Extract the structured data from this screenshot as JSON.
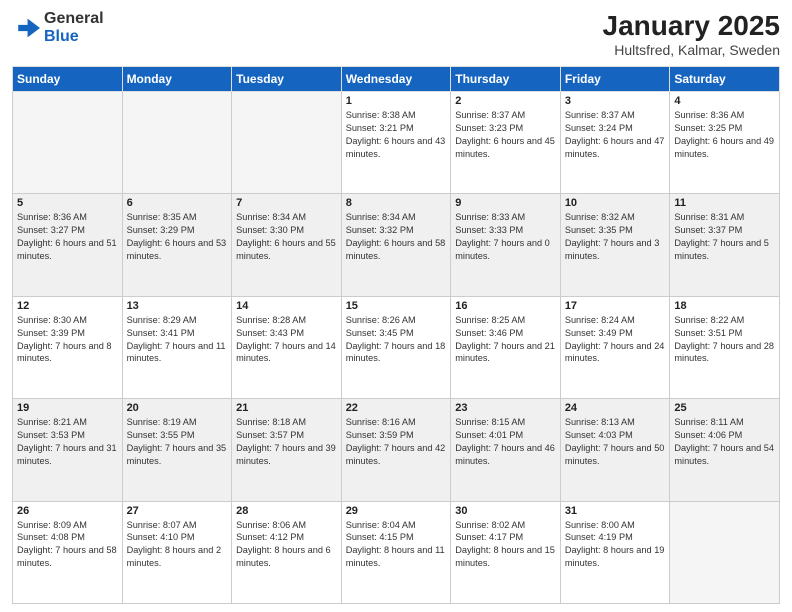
{
  "header": {
    "logo_general": "General",
    "logo_blue": "Blue",
    "month": "January 2025",
    "location": "Hultsfred, Kalmar, Sweden"
  },
  "weekdays": [
    "Sunday",
    "Monday",
    "Tuesday",
    "Wednesday",
    "Thursday",
    "Friday",
    "Saturday"
  ],
  "weeks": [
    [
      {
        "day": "",
        "sunrise": "",
        "sunset": "",
        "daylight": "",
        "empty": true
      },
      {
        "day": "",
        "sunrise": "",
        "sunset": "",
        "daylight": "",
        "empty": true
      },
      {
        "day": "",
        "sunrise": "",
        "sunset": "",
        "daylight": "",
        "empty": true
      },
      {
        "day": "1",
        "sunrise": "Sunrise: 8:38 AM",
        "sunset": "Sunset: 3:21 PM",
        "daylight": "Daylight: 6 hours and 43 minutes."
      },
      {
        "day": "2",
        "sunrise": "Sunrise: 8:37 AM",
        "sunset": "Sunset: 3:23 PM",
        "daylight": "Daylight: 6 hours and 45 minutes."
      },
      {
        "day": "3",
        "sunrise": "Sunrise: 8:37 AM",
        "sunset": "Sunset: 3:24 PM",
        "daylight": "Daylight: 6 hours and 47 minutes."
      },
      {
        "day": "4",
        "sunrise": "Sunrise: 8:36 AM",
        "sunset": "Sunset: 3:25 PM",
        "daylight": "Daylight: 6 hours and 49 minutes."
      }
    ],
    [
      {
        "day": "5",
        "sunrise": "Sunrise: 8:36 AM",
        "sunset": "Sunset: 3:27 PM",
        "daylight": "Daylight: 6 hours and 51 minutes."
      },
      {
        "day": "6",
        "sunrise": "Sunrise: 8:35 AM",
        "sunset": "Sunset: 3:29 PM",
        "daylight": "Daylight: 6 hours and 53 minutes."
      },
      {
        "day": "7",
        "sunrise": "Sunrise: 8:34 AM",
        "sunset": "Sunset: 3:30 PM",
        "daylight": "Daylight: 6 hours and 55 minutes."
      },
      {
        "day": "8",
        "sunrise": "Sunrise: 8:34 AM",
        "sunset": "Sunset: 3:32 PM",
        "daylight": "Daylight: 6 hours and 58 minutes."
      },
      {
        "day": "9",
        "sunrise": "Sunrise: 8:33 AM",
        "sunset": "Sunset: 3:33 PM",
        "daylight": "Daylight: 7 hours and 0 minutes."
      },
      {
        "day": "10",
        "sunrise": "Sunrise: 8:32 AM",
        "sunset": "Sunset: 3:35 PM",
        "daylight": "Daylight: 7 hours and 3 minutes."
      },
      {
        "day": "11",
        "sunrise": "Sunrise: 8:31 AM",
        "sunset": "Sunset: 3:37 PM",
        "daylight": "Daylight: 7 hours and 5 minutes."
      }
    ],
    [
      {
        "day": "12",
        "sunrise": "Sunrise: 8:30 AM",
        "sunset": "Sunset: 3:39 PM",
        "daylight": "Daylight: 7 hours and 8 minutes."
      },
      {
        "day": "13",
        "sunrise": "Sunrise: 8:29 AM",
        "sunset": "Sunset: 3:41 PM",
        "daylight": "Daylight: 7 hours and 11 minutes."
      },
      {
        "day": "14",
        "sunrise": "Sunrise: 8:28 AM",
        "sunset": "Sunset: 3:43 PM",
        "daylight": "Daylight: 7 hours and 14 minutes."
      },
      {
        "day": "15",
        "sunrise": "Sunrise: 8:26 AM",
        "sunset": "Sunset: 3:45 PM",
        "daylight": "Daylight: 7 hours and 18 minutes."
      },
      {
        "day": "16",
        "sunrise": "Sunrise: 8:25 AM",
        "sunset": "Sunset: 3:46 PM",
        "daylight": "Daylight: 7 hours and 21 minutes."
      },
      {
        "day": "17",
        "sunrise": "Sunrise: 8:24 AM",
        "sunset": "Sunset: 3:49 PM",
        "daylight": "Daylight: 7 hours and 24 minutes."
      },
      {
        "day": "18",
        "sunrise": "Sunrise: 8:22 AM",
        "sunset": "Sunset: 3:51 PM",
        "daylight": "Daylight: 7 hours and 28 minutes."
      }
    ],
    [
      {
        "day": "19",
        "sunrise": "Sunrise: 8:21 AM",
        "sunset": "Sunset: 3:53 PM",
        "daylight": "Daylight: 7 hours and 31 minutes."
      },
      {
        "day": "20",
        "sunrise": "Sunrise: 8:19 AM",
        "sunset": "Sunset: 3:55 PM",
        "daylight": "Daylight: 7 hours and 35 minutes."
      },
      {
        "day": "21",
        "sunrise": "Sunrise: 8:18 AM",
        "sunset": "Sunset: 3:57 PM",
        "daylight": "Daylight: 7 hours and 39 minutes."
      },
      {
        "day": "22",
        "sunrise": "Sunrise: 8:16 AM",
        "sunset": "Sunset: 3:59 PM",
        "daylight": "Daylight: 7 hours and 42 minutes."
      },
      {
        "day": "23",
        "sunrise": "Sunrise: 8:15 AM",
        "sunset": "Sunset: 4:01 PM",
        "daylight": "Daylight: 7 hours and 46 minutes."
      },
      {
        "day": "24",
        "sunrise": "Sunrise: 8:13 AM",
        "sunset": "Sunset: 4:03 PM",
        "daylight": "Daylight: 7 hours and 50 minutes."
      },
      {
        "day": "25",
        "sunrise": "Sunrise: 8:11 AM",
        "sunset": "Sunset: 4:06 PM",
        "daylight": "Daylight: 7 hours and 54 minutes."
      }
    ],
    [
      {
        "day": "26",
        "sunrise": "Sunrise: 8:09 AM",
        "sunset": "Sunset: 4:08 PM",
        "daylight": "Daylight: 7 hours and 58 minutes."
      },
      {
        "day": "27",
        "sunrise": "Sunrise: 8:07 AM",
        "sunset": "Sunset: 4:10 PM",
        "daylight": "Daylight: 8 hours and 2 minutes."
      },
      {
        "day": "28",
        "sunrise": "Sunrise: 8:06 AM",
        "sunset": "Sunset: 4:12 PM",
        "daylight": "Daylight: 8 hours and 6 minutes."
      },
      {
        "day": "29",
        "sunrise": "Sunrise: 8:04 AM",
        "sunset": "Sunset: 4:15 PM",
        "daylight": "Daylight: 8 hours and 11 minutes."
      },
      {
        "day": "30",
        "sunrise": "Sunrise: 8:02 AM",
        "sunset": "Sunset: 4:17 PM",
        "daylight": "Daylight: 8 hours and 15 minutes."
      },
      {
        "day": "31",
        "sunrise": "Sunrise: 8:00 AM",
        "sunset": "Sunset: 4:19 PM",
        "daylight": "Daylight: 8 hours and 19 minutes."
      },
      {
        "day": "",
        "sunrise": "",
        "sunset": "",
        "daylight": "",
        "empty": true
      }
    ]
  ]
}
